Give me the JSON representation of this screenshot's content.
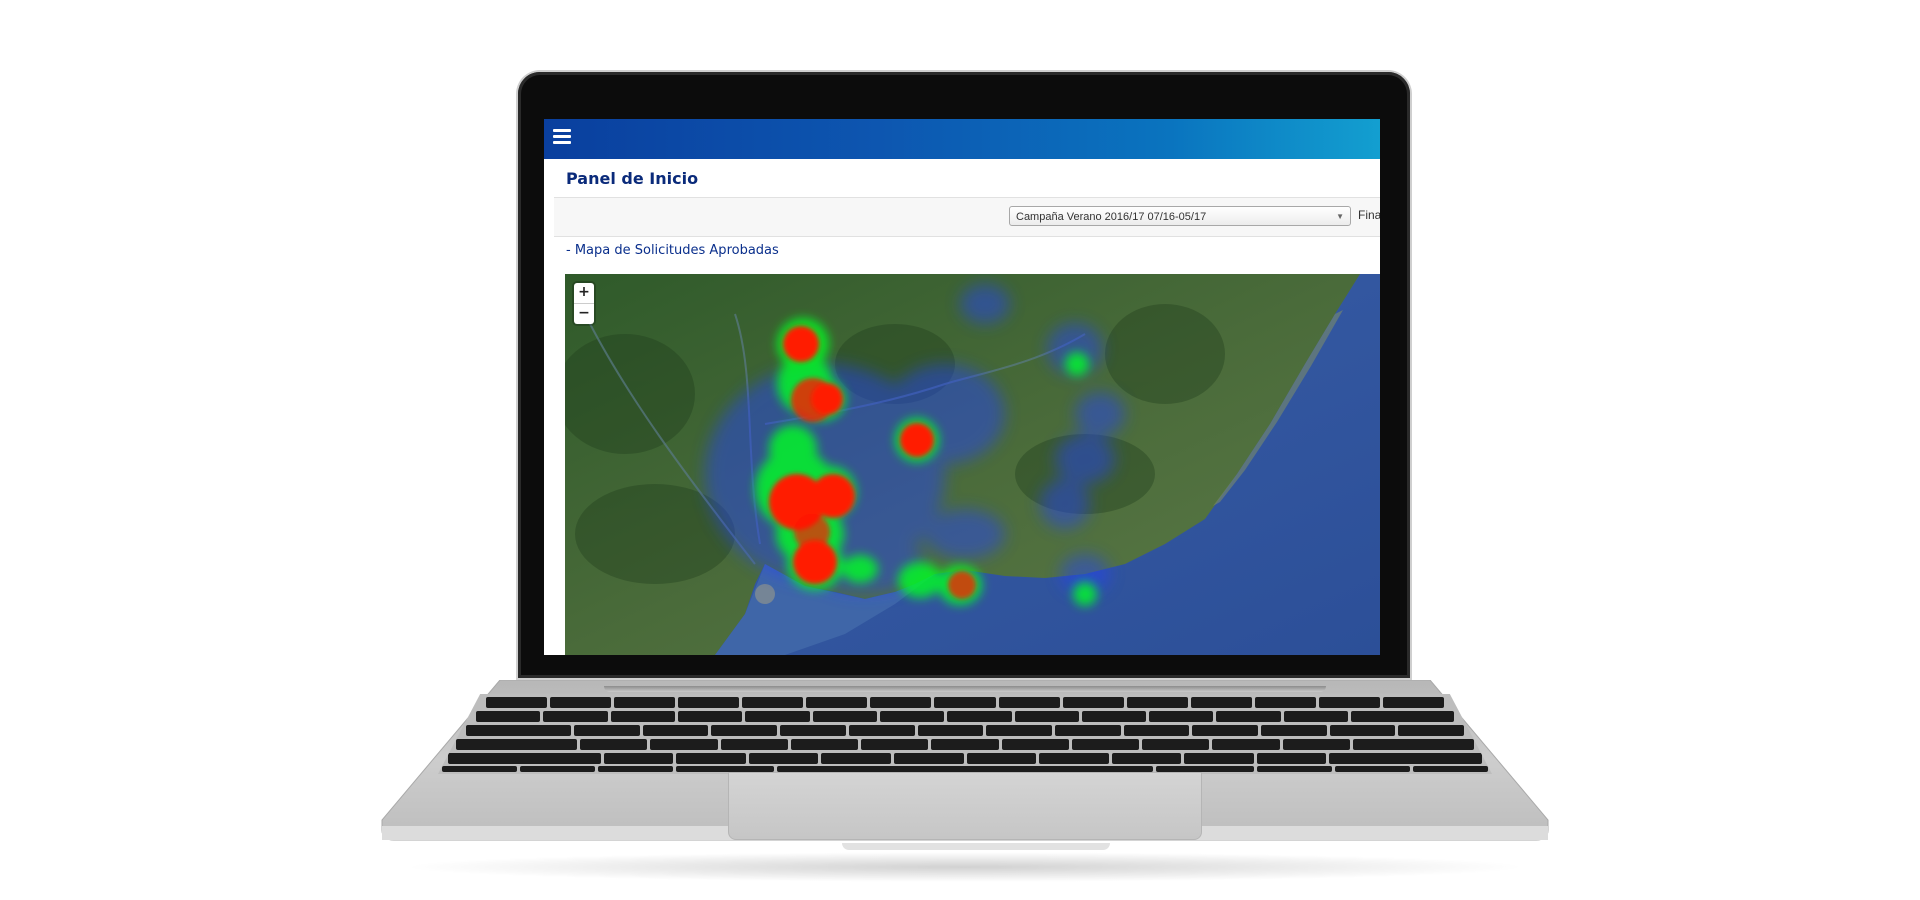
{
  "app": {
    "page_title": "Panel de Inicio",
    "menu_icon": "hamburger-menu-icon",
    "brand_colors": {
      "header_start": "#0a3f9e",
      "header_end": "#139fd0",
      "title": "#0a2a7a"
    }
  },
  "filters": {
    "campaign_select_value": "Campaña Verano 2016/17 07/16-05/17",
    "cut_label": "Fina"
  },
  "section": {
    "map_title": "- Mapa de Solicitudes Aprobadas"
  },
  "map": {
    "zoom_in_label": "+",
    "zoom_out_label": "−",
    "layer": "satellite",
    "heatmap_colors": {
      "low": "#2040ff",
      "mid": "#00ff20",
      "high": "#ff1a00"
    }
  }
}
